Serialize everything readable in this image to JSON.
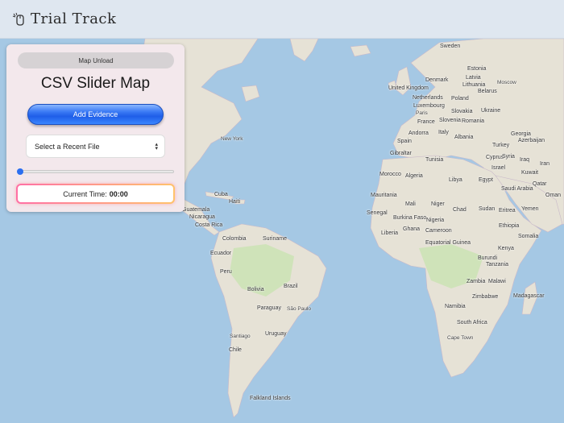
{
  "header": {
    "brand": "Trial Track",
    "logo_icon": "mouse-cursor-icon"
  },
  "panel": {
    "unload_label": "Map Unload",
    "title": "CSV Slider Map",
    "add_label": "Add Evidence",
    "select": {
      "selected": "Select a Recent File"
    },
    "slider": {
      "value": 0
    },
    "time_label": "Current Time:",
    "time_value": "00:00"
  },
  "colors": {
    "accent": "#2b6ff0",
    "header_bg": "#dfe7f0",
    "panel_bg": "#f3e8ec",
    "water": "#a5c8e4",
    "land": "#e6e2d6"
  },
  "map_labels": [
    {
      "name": "Sweden"
    },
    {
      "name": "Estonia"
    },
    {
      "name": "Latvia"
    },
    {
      "name": "Denmark"
    },
    {
      "name": "Lithuania"
    },
    {
      "name": "Moscow"
    },
    {
      "name": "United Kingdom"
    },
    {
      "name": "Belarus"
    },
    {
      "name": "Netherlands"
    },
    {
      "name": "Poland"
    },
    {
      "name": "Luxembourg"
    },
    {
      "name": "Slovakia"
    },
    {
      "name": "Ukraine"
    },
    {
      "name": "Paris"
    },
    {
      "name": "France"
    },
    {
      "name": "Slovenia"
    },
    {
      "name": "Romania"
    },
    {
      "name": "Andorra"
    },
    {
      "name": "Italy"
    },
    {
      "name": "Georgia"
    },
    {
      "name": "Spain"
    },
    {
      "name": "Albania"
    },
    {
      "name": "Azerbaijan"
    },
    {
      "name": "Turkey"
    },
    {
      "name": "Gibraltar"
    },
    {
      "name": "Cyprus"
    },
    {
      "name": "Syria"
    },
    {
      "name": "Tunisia"
    },
    {
      "name": "Iraq"
    },
    {
      "name": "Iran"
    },
    {
      "name": "Israel"
    },
    {
      "name": "Kuwait"
    },
    {
      "name": "Morocco"
    },
    {
      "name": "Algeria"
    },
    {
      "name": "Libya"
    },
    {
      "name": "Egypt"
    },
    {
      "name": "Qatar"
    },
    {
      "name": "Saudi Arabia"
    },
    {
      "name": "Mauritania"
    },
    {
      "name": "Oman"
    },
    {
      "name": "Mali"
    },
    {
      "name": "Niger"
    },
    {
      "name": "Chad"
    },
    {
      "name": "Sudan"
    },
    {
      "name": "Eritrea"
    },
    {
      "name": "Yemen"
    },
    {
      "name": "Senegal"
    },
    {
      "name": "Burkina Faso"
    },
    {
      "name": "Nigeria"
    },
    {
      "name": "Ethiopia"
    },
    {
      "name": "Liberia"
    },
    {
      "name": "Ghana"
    },
    {
      "name": "Cameroon"
    },
    {
      "name": "Somalia"
    },
    {
      "name": "Equatorial Guinea"
    },
    {
      "name": "Kenya"
    },
    {
      "name": "Burundi"
    },
    {
      "name": "Tanzania"
    },
    {
      "name": "Zambia"
    },
    {
      "name": "Malawi"
    },
    {
      "name": "Zimbabwe"
    },
    {
      "name": "Madagascar"
    },
    {
      "name": "Namibia"
    },
    {
      "name": "South Africa"
    },
    {
      "name": "Cape Town"
    },
    {
      "name": "New York"
    },
    {
      "name": "Cuba"
    },
    {
      "name": "Haiti"
    },
    {
      "name": "Guatemala"
    },
    {
      "name": "Nicaragua"
    },
    {
      "name": "Costa Rica"
    },
    {
      "name": "Colombia"
    },
    {
      "name": "Suriname"
    },
    {
      "name": "Ecuador"
    },
    {
      "name": "Peru"
    },
    {
      "name": "Brazil"
    },
    {
      "name": "Bolivia"
    },
    {
      "name": "Paraguay"
    },
    {
      "name": "São Paulo"
    },
    {
      "name": "Santiago"
    },
    {
      "name": "Uruguay"
    },
    {
      "name": "Chile"
    },
    {
      "name": "Falkland Islands"
    }
  ]
}
